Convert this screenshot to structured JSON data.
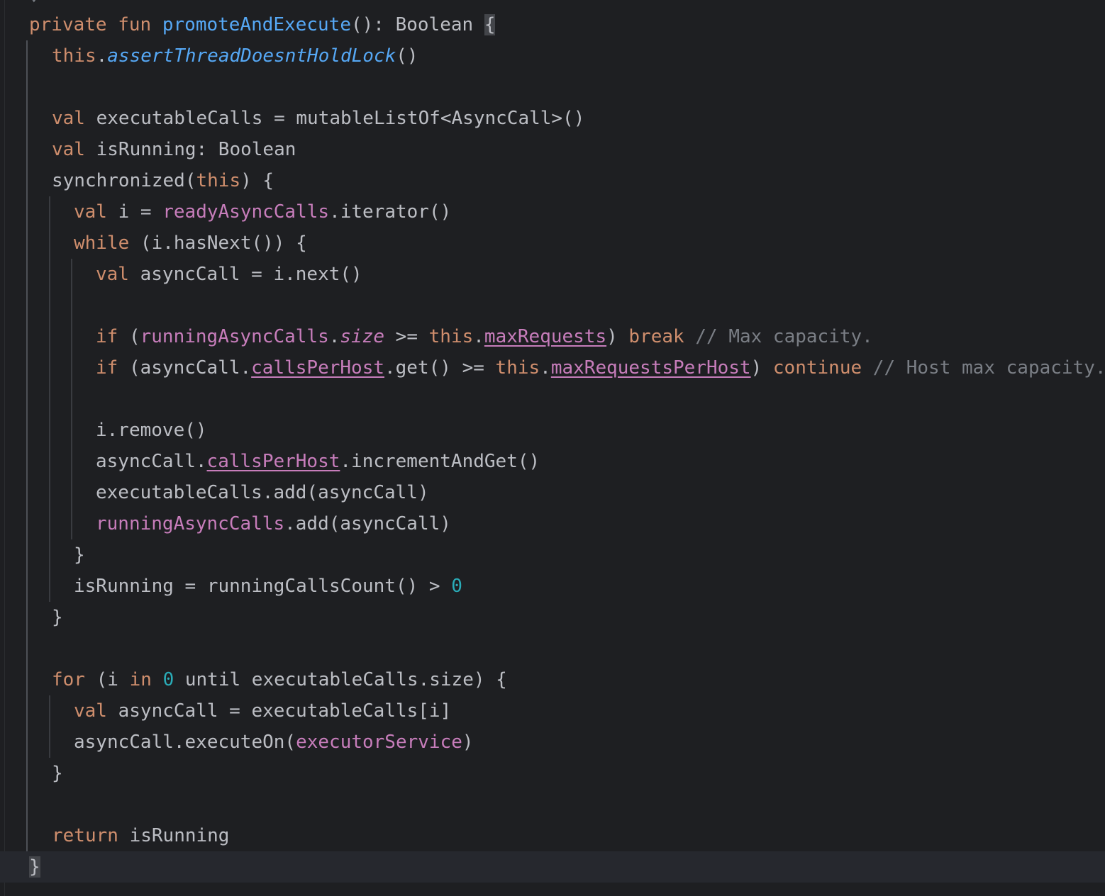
{
  "editor": {
    "language": "Kotlin",
    "theme_colors": {
      "background": "#1e1f22",
      "keyword": "#cf8e6d",
      "function": "#56a8f5",
      "property": "#c77dbb",
      "number": "#2aacb8",
      "comment": "#7a7e85",
      "text": "#bcbec4"
    },
    "lines": [
      {
        "indent": 1,
        "tokens": [
          {
            "t": "private",
            "c": "kw"
          },
          {
            "t": " ",
            "c": "plain"
          },
          {
            "t": "fun",
            "c": "kw"
          },
          {
            "t": " ",
            "c": "plain"
          },
          {
            "t": "promoteAndExecute",
            "c": "fn"
          },
          {
            "t": "(): Boolean ",
            "c": "plain"
          },
          {
            "t": "{",
            "c": "brace-hl"
          }
        ]
      },
      {
        "indent": 2,
        "tokens": [
          {
            "t": "this",
            "c": "kw"
          },
          {
            "t": ".",
            "c": "plain"
          },
          {
            "t": "assertThreadDoesntHoldLock",
            "c": "ext"
          },
          {
            "t": "()",
            "c": "plain"
          }
        ]
      },
      {
        "indent": 2,
        "tokens": []
      },
      {
        "indent": 2,
        "tokens": [
          {
            "t": "val",
            "c": "kw"
          },
          {
            "t": " executableCalls = mutableListOf<AsyncCall>()",
            "c": "plain"
          }
        ]
      },
      {
        "indent": 2,
        "tokens": [
          {
            "t": "val",
            "c": "kw"
          },
          {
            "t": " isRunning: Boolean",
            "c": "plain"
          }
        ]
      },
      {
        "indent": 2,
        "tokens": [
          {
            "t": "synchronized(",
            "c": "plain"
          },
          {
            "t": "this",
            "c": "kw"
          },
          {
            "t": ") {",
            "c": "plain"
          }
        ]
      },
      {
        "indent": 3,
        "tokens": [
          {
            "t": "val",
            "c": "kw"
          },
          {
            "t": " i = ",
            "c": "plain"
          },
          {
            "t": "readyAsyncCalls",
            "c": "prop"
          },
          {
            "t": ".iterator()",
            "c": "plain"
          }
        ]
      },
      {
        "indent": 3,
        "tokens": [
          {
            "t": "while",
            "c": "kw"
          },
          {
            "t": " (i.hasNext()) {",
            "c": "plain"
          }
        ]
      },
      {
        "indent": 4,
        "tokens": [
          {
            "t": "val",
            "c": "kw"
          },
          {
            "t": " asyncCall = i.next()",
            "c": "plain"
          }
        ]
      },
      {
        "indent": 4,
        "tokens": []
      },
      {
        "indent": 4,
        "tokens": [
          {
            "t": "if",
            "c": "kw"
          },
          {
            "t": " (",
            "c": "plain"
          },
          {
            "t": "runningAsyncCalls",
            "c": "prop"
          },
          {
            "t": ".",
            "c": "plain"
          },
          {
            "t": "size",
            "c": "prop-it"
          },
          {
            "t": " >= ",
            "c": "plain"
          },
          {
            "t": "this",
            "c": "kw"
          },
          {
            "t": ".",
            "c": "plain"
          },
          {
            "t": "maxRequests",
            "c": "prop under"
          },
          {
            "t": ") ",
            "c": "plain"
          },
          {
            "t": "break",
            "c": "kw"
          },
          {
            "t": " // Max capacity.",
            "c": "cmt"
          }
        ]
      },
      {
        "indent": 4,
        "tokens": [
          {
            "t": "if",
            "c": "kw"
          },
          {
            "t": " (asyncCall.",
            "c": "plain"
          },
          {
            "t": "callsPerHost",
            "c": "prop under"
          },
          {
            "t": ".get() >= ",
            "c": "plain"
          },
          {
            "t": "this",
            "c": "kw"
          },
          {
            "t": ".",
            "c": "plain"
          },
          {
            "t": "maxRequestsPerHost",
            "c": "prop under"
          },
          {
            "t": ") ",
            "c": "plain"
          },
          {
            "t": "continue",
            "c": "kw"
          },
          {
            "t": " // Host max capacity.",
            "c": "cmt"
          }
        ]
      },
      {
        "indent": 4,
        "tokens": []
      },
      {
        "indent": 4,
        "tokens": [
          {
            "t": "i.remove()",
            "c": "plain"
          }
        ]
      },
      {
        "indent": 4,
        "tokens": [
          {
            "t": "asyncCall.",
            "c": "plain"
          },
          {
            "t": "callsPerHost",
            "c": "prop under"
          },
          {
            "t": ".incrementAndGet()",
            "c": "plain"
          }
        ]
      },
      {
        "indent": 4,
        "tokens": [
          {
            "t": "executableCalls.add(asyncCall)",
            "c": "plain"
          }
        ]
      },
      {
        "indent": 4,
        "tokens": [
          {
            "t": "runningAsyncCalls",
            "c": "prop"
          },
          {
            "t": ".add(asyncCall)",
            "c": "plain"
          }
        ]
      },
      {
        "indent": 3,
        "tokens": [
          {
            "t": "}",
            "c": "plain"
          }
        ]
      },
      {
        "indent": 3,
        "tokens": [
          {
            "t": "isRunning = runningCallsCount() > ",
            "c": "plain"
          },
          {
            "t": "0",
            "c": "num"
          }
        ]
      },
      {
        "indent": 2,
        "tokens": [
          {
            "t": "}",
            "c": "plain"
          }
        ]
      },
      {
        "indent": 2,
        "tokens": []
      },
      {
        "indent": 2,
        "tokens": [
          {
            "t": "for",
            "c": "kw"
          },
          {
            "t": " (i ",
            "c": "plain"
          },
          {
            "t": "in",
            "c": "kw"
          },
          {
            "t": " ",
            "c": "plain"
          },
          {
            "t": "0",
            "c": "num"
          },
          {
            "t": " until executableCalls.size) {",
            "c": "plain"
          }
        ]
      },
      {
        "indent": 3,
        "tokens": [
          {
            "t": "val",
            "c": "kw"
          },
          {
            "t": " asyncCall = executableCalls[i]",
            "c": "plain"
          }
        ]
      },
      {
        "indent": 3,
        "tokens": [
          {
            "t": "asyncCall.executeOn(",
            "c": "plain"
          },
          {
            "t": "executorService",
            "c": "prop"
          },
          {
            "t": ")",
            "c": "plain"
          }
        ]
      },
      {
        "indent": 2,
        "tokens": [
          {
            "t": "}",
            "c": "plain"
          }
        ]
      },
      {
        "indent": 2,
        "tokens": []
      },
      {
        "indent": 2,
        "tokens": [
          {
            "t": "return",
            "c": "kw"
          },
          {
            "t": " isRunning",
            "c": "plain"
          }
        ]
      },
      {
        "indent": 1,
        "current": true,
        "tokens": [
          {
            "t": "}",
            "c": "brace-hl"
          }
        ]
      }
    ]
  }
}
